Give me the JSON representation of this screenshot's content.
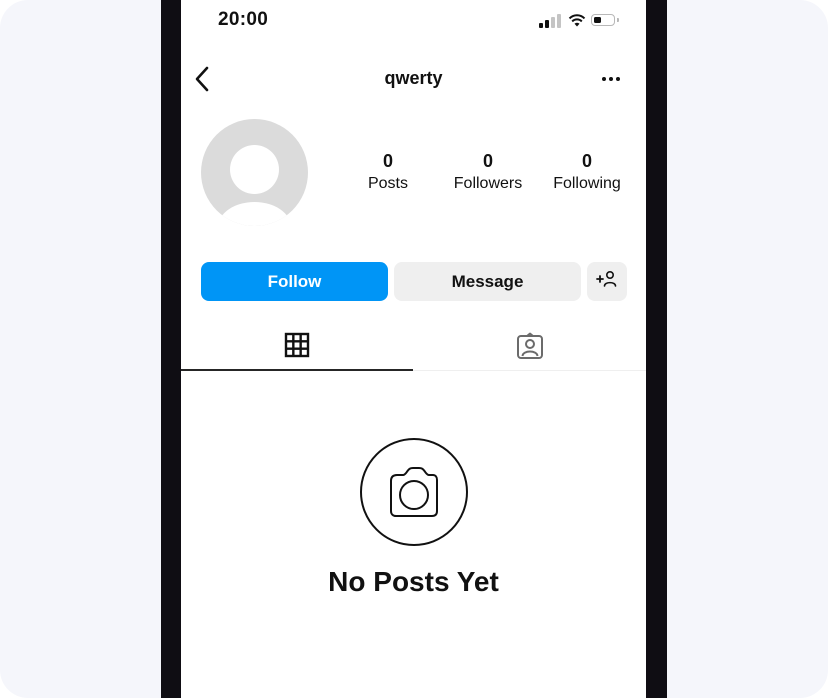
{
  "status_bar": {
    "time": "20:00",
    "icons": [
      "cellular-signal-icon",
      "wifi-icon",
      "battery-icon"
    ],
    "battery_level": 0.35
  },
  "nav": {
    "back_icon": "chevron-left-icon",
    "title": "qwerty",
    "more_icon": "ellipsis-icon"
  },
  "profile": {
    "avatar_icon": "default-avatar-icon",
    "stats": [
      {
        "value": "0",
        "label": "Posts"
      },
      {
        "value": "0",
        "label": "Followers"
      },
      {
        "value": "0",
        "label": "Following"
      }
    ]
  },
  "actions": {
    "follow_label": "Follow",
    "message_label": "Message",
    "add_user_icon": "add-user-icon"
  },
  "tabs": [
    {
      "name": "posts-grid",
      "icon": "grid-icon",
      "active": true
    },
    {
      "name": "tagged",
      "icon": "tagged-user-icon",
      "active": false
    }
  ],
  "empty_state": {
    "icon": "camera-icon",
    "title": "No Posts Yet"
  },
  "colors": {
    "accent": "#0095f6",
    "secondary_button": "#efefef",
    "text": "#111111",
    "avatar_placeholder": "#dbdbdb",
    "background": "#f5f6fb",
    "bezel": "#0f0d13"
  }
}
